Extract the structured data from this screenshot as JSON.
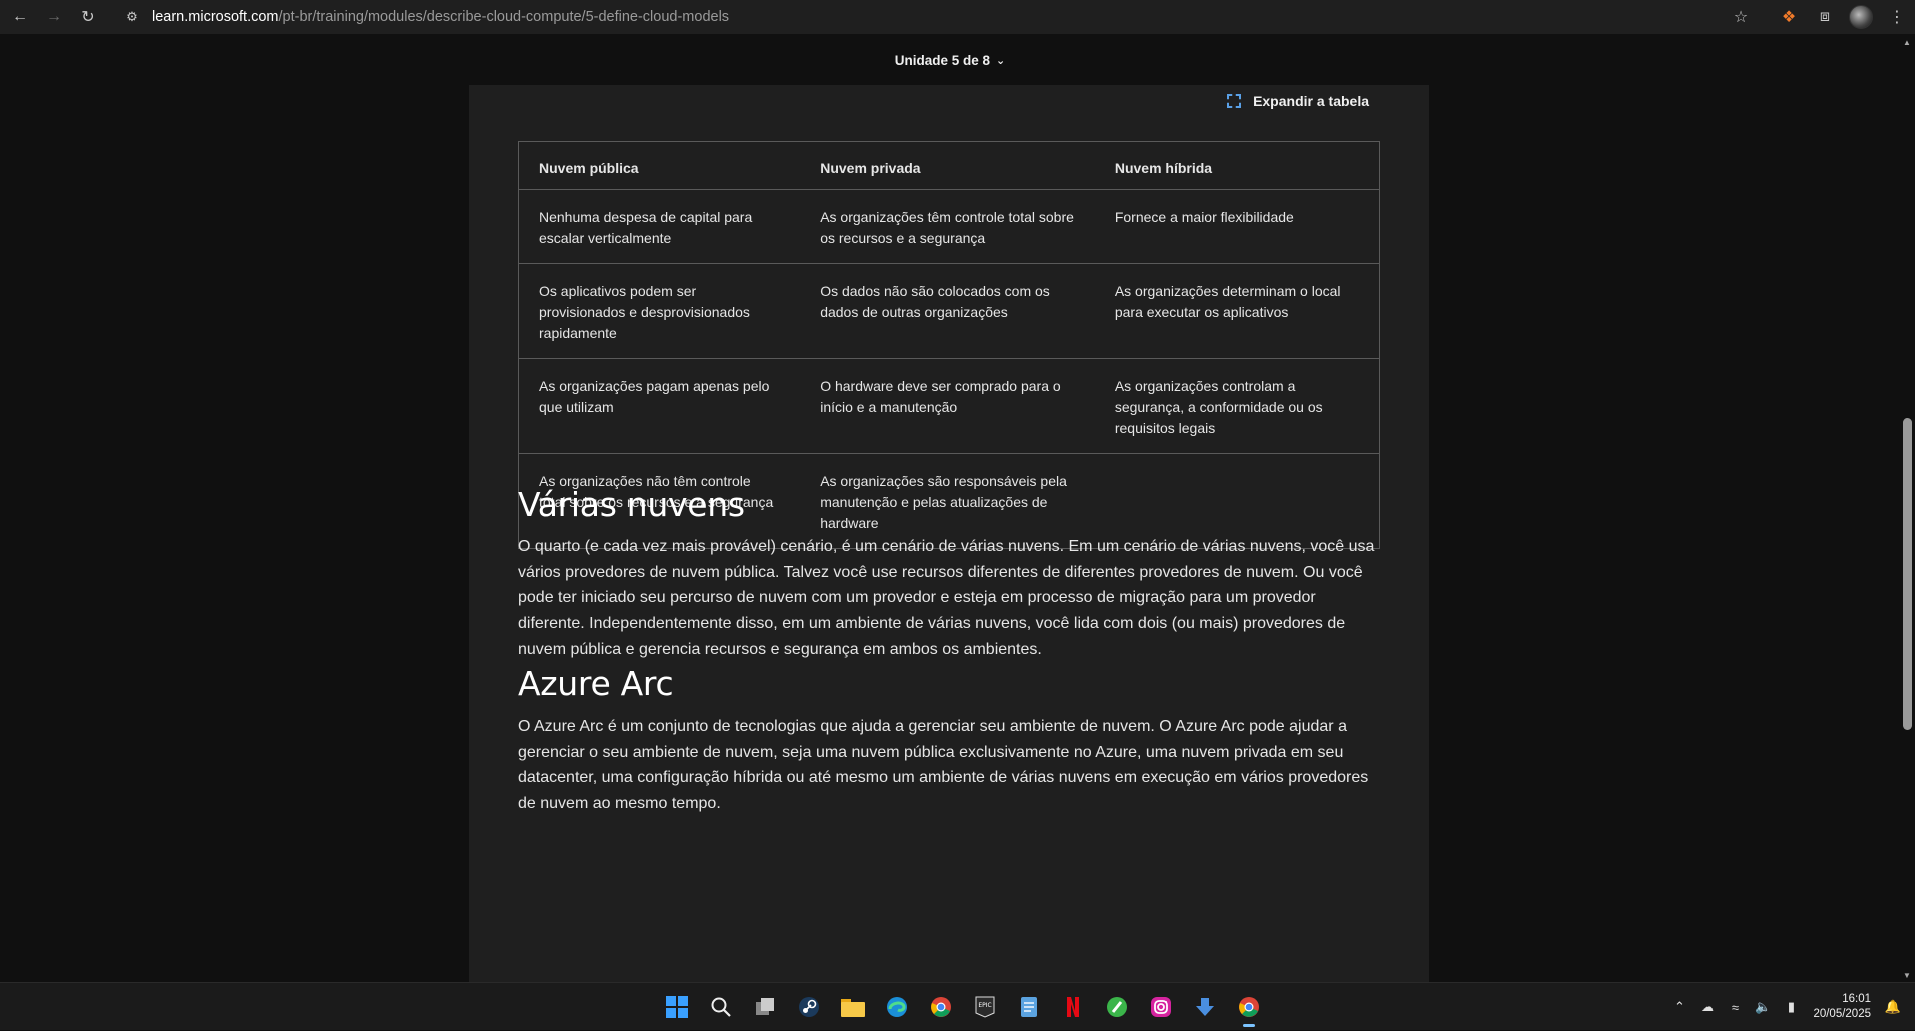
{
  "browser": {
    "url_host": "learn.microsoft.com",
    "url_path": "/pt-br/training/modules/describe-cloud-compute/5-define-cloud-models"
  },
  "page": {
    "unit_label": "Unidade 5 de 8",
    "expand_label": "Expandir a tabela",
    "table": {
      "headers": [
        "Nuvem pública",
        "Nuvem privada",
        "Nuvem híbrida"
      ],
      "rows": [
        [
          "Nenhuma despesa de capital para escalar verticalmente",
          "As organizações têm controle total sobre os recursos e a segurança",
          "Fornece a maior flexibilidade"
        ],
        [
          "Os aplicativos podem ser provisionados e desprovisionados rapidamente",
          "Os dados não são colocados com os dados de outras organizações",
          "As organizações determinam o local para executar os aplicativos"
        ],
        [
          "As organizações pagam apenas pelo que utilizam",
          "O hardware deve ser comprado para o início e a manutenção",
          "As organizações controlam a segurança, a conformidade ou os requisitos legais"
        ],
        [
          "As organizações não têm controle total sobre os recursos e a segurança",
          "As organizações são responsáveis pela manutenção e pelas atualizações de hardware",
          ""
        ]
      ]
    },
    "section1": {
      "heading": "Várias nuvens",
      "body": "O quarto (e cada vez mais provável) cenário, é um cenário de várias nuvens. Em um cenário de várias nuvens, você usa vários provedores de nuvem pública. Talvez você use recursos diferentes de diferentes provedores de nuvem. Ou você pode ter iniciado seu percurso de nuvem com um provedor e esteja em processo de migração para um provedor diferente. Independentemente disso, em um ambiente de várias nuvens, você lida com dois (ou mais) provedores de nuvem pública e gerencia recursos e segurança em ambos os ambientes."
    },
    "section2": {
      "heading": "Azure Arc",
      "body": "O Azure Arc é um conjunto de tecnologias que ajuda a gerenciar seu ambiente de nuvem. O Azure Arc pode ajudar a gerenciar o seu ambiente de nuvem, seja uma nuvem pública exclusivamente no Azure, uma nuvem privada em seu datacenter, uma configuração híbrida ou até mesmo um ambiente de várias nuvens em execução em vários provedores de nuvem ao mesmo tempo."
    }
  },
  "taskbar": {
    "apps": [
      "windows-start",
      "search",
      "task-view",
      "steam",
      "file-explorer",
      "edge",
      "chrome",
      "epic-games",
      "notepad",
      "netflix",
      "utorrent",
      "instagram",
      "downloader",
      "chrome-active"
    ],
    "time": "16:01",
    "date": "20/05/2025"
  },
  "colors": {
    "page_bg": "#101010",
    "content_bg": "#1f1f1f",
    "table_border": "#5a5a5a",
    "accent": "#5aa0e6"
  }
}
